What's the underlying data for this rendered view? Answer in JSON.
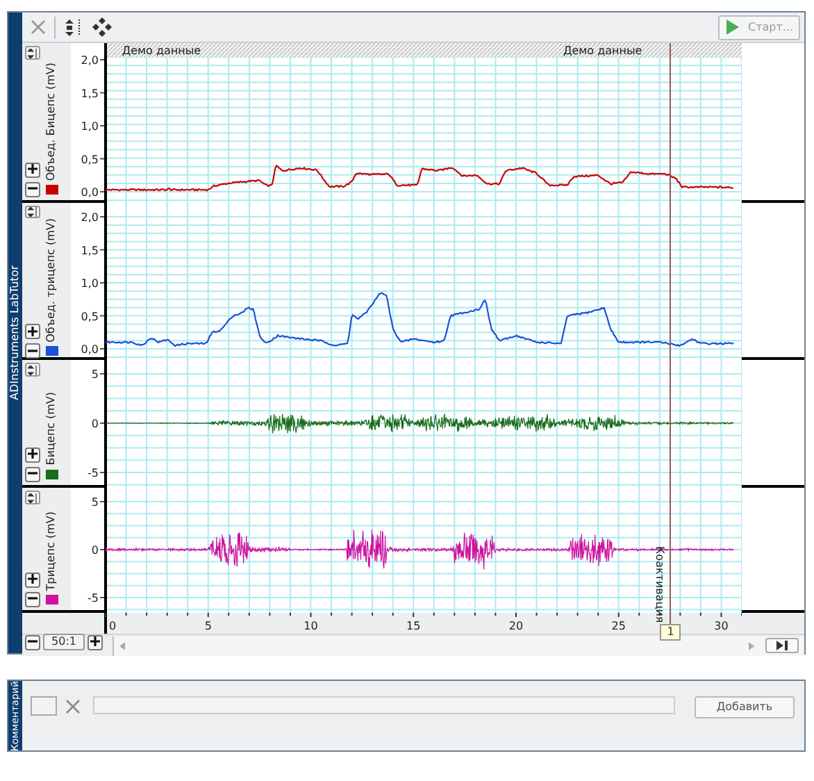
{
  "toolbar": {
    "start_button": {
      "label": "Старт...",
      "disabled": true
    }
  },
  "side_label": "ADInstruments LabTutor",
  "data_header": [
    "Демо данные",
    "Демо данные"
  ],
  "channels": [
    {
      "label": "Объед. Бицепс (mV)",
      "color": "#cc0000",
      "kind": "envelope",
      "y_ticks": [
        "2,0",
        "1,5",
        "1,0",
        "0,5",
        "0,0"
      ]
    },
    {
      "label": "Объед. трицепс (mV)",
      "color": "#1e4fd8",
      "kind": "envelope",
      "y_ticks": [
        "2,0",
        "1,5",
        "1,0",
        "0,5",
        "0,0"
      ]
    },
    {
      "label": "Бицепс (mV)",
      "color": "#1a6b1a",
      "kind": "raw",
      "y_ticks": [
        "5",
        "0",
        "-5"
      ]
    },
    {
      "label": "Трицепс (mV)",
      "color": "#d010a0",
      "kind": "raw",
      "y_ticks": [
        "5",
        "0",
        "-5"
      ]
    }
  ],
  "x_ticks": [
    "0",
    "5",
    "10",
    "15",
    "20",
    "25",
    "30"
  ],
  "marker": {
    "label": "Коактивация",
    "number": "1"
  },
  "zoom": {
    "ratio": "50:1"
  },
  "comment_panel": {
    "side_label": "Комментарий",
    "button": "Добавить"
  }
}
